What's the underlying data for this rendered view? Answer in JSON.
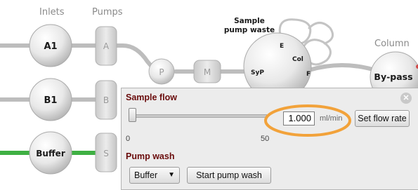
{
  "headers": {
    "inlets": "Inlets",
    "pumps": "Pumps",
    "column": "Column"
  },
  "sample_pump_waste": {
    "line1": "Sample",
    "line2": "pump waste"
  },
  "inlets": [
    "A1",
    "B1",
    "Buffer"
  ],
  "pumps": [
    "A",
    "B",
    "S"
  ],
  "mixer": {
    "p": "P",
    "m": "M"
  },
  "sample_pump": {
    "label": "SyP",
    "port_e": "E",
    "port_col": "Col",
    "port_f": "F"
  },
  "bypass": "By-pass",
  "panel": {
    "sample_flow_title": "Sample flow",
    "slider_min": "0",
    "slider_mid": "50",
    "slider_fraction": 0.0,
    "flow_value": "1.000",
    "flow_unit": "ml/min",
    "set_flow_button": "Set flow rate",
    "pump_wash_title": "Pump wash",
    "wash_select": "Buffer",
    "start_wash_button": "Start pump wash",
    "close_icon": "close-icon"
  },
  "colors": {
    "highlight": "#f2a23a",
    "buffer_line": "#3fb043",
    "title": "#6a0c0c"
  }
}
